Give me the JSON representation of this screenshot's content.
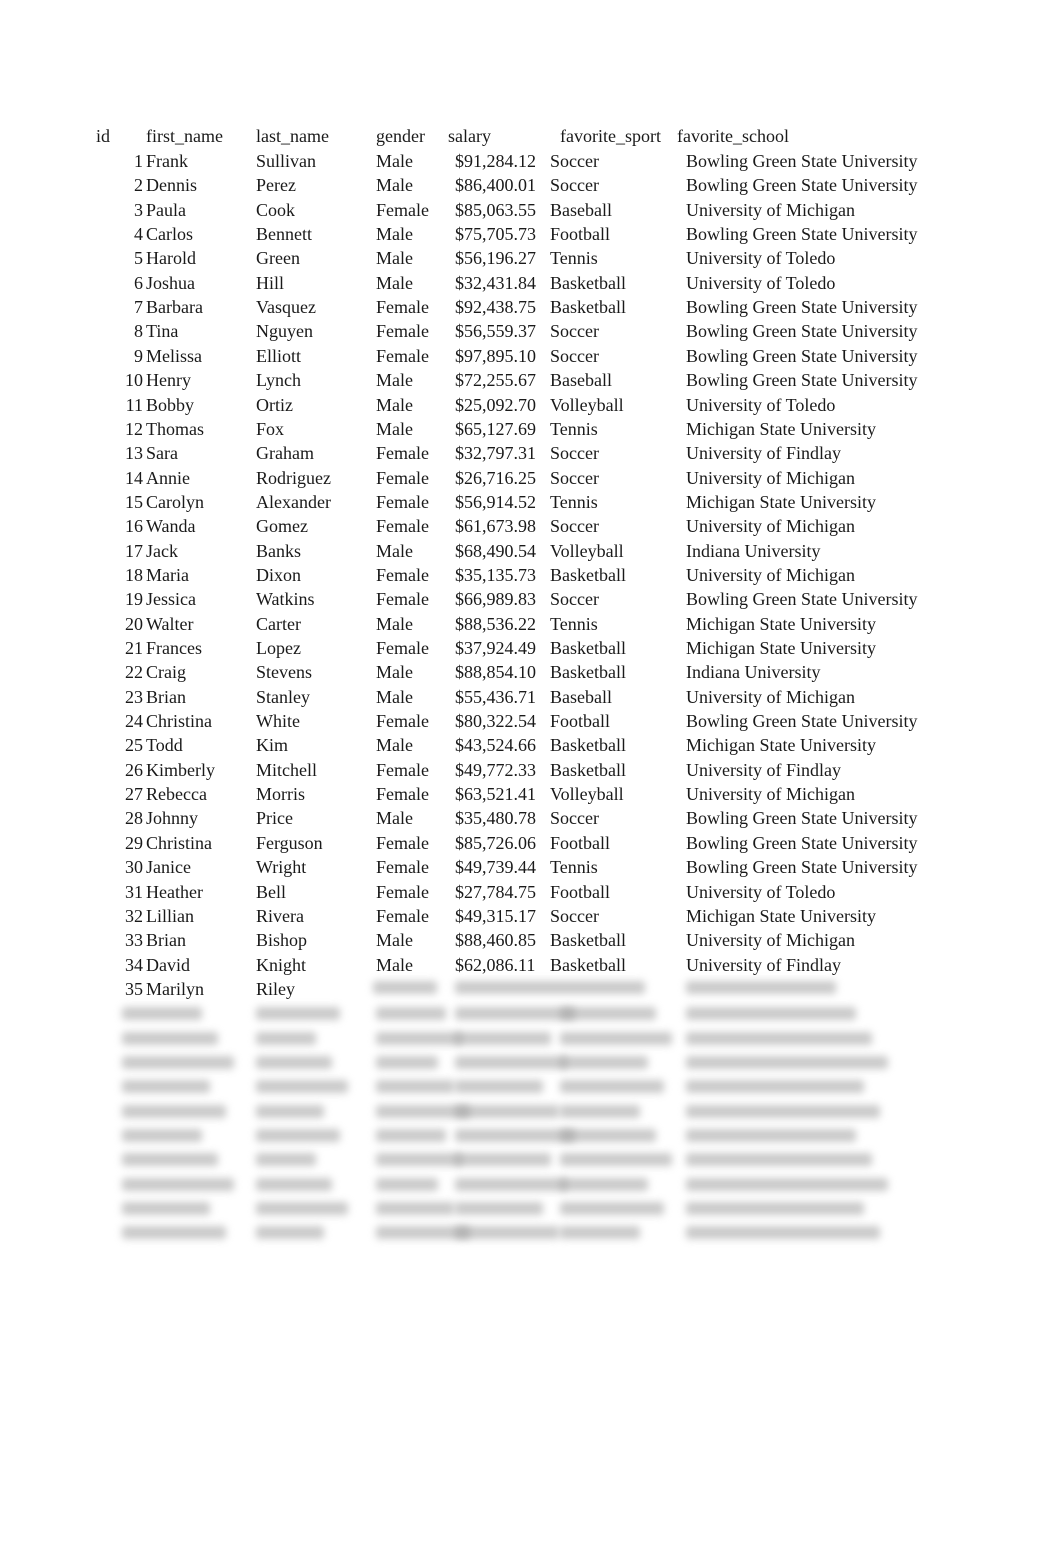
{
  "table": {
    "headers": {
      "id": "id",
      "first_name": "first_name",
      "last_name": "last_name",
      "gender": "gender",
      "salary": "salary",
      "favorite_sport": "favorite_sport",
      "favorite_school": "favorite_school"
    },
    "rows": [
      {
        "id": "1",
        "first_name": "Frank",
        "last_name": "Sullivan",
        "gender": "Male",
        "salary": "$91,284.12",
        "favorite_sport": "Soccer",
        "favorite_school": "Bowling Green State University"
      },
      {
        "id": "2",
        "first_name": "Dennis",
        "last_name": "Perez",
        "gender": "Male",
        "salary": "$86,400.01",
        "favorite_sport": "Soccer",
        "favorite_school": "Bowling Green State University"
      },
      {
        "id": "3",
        "first_name": "Paula",
        "last_name": "Cook",
        "gender": "Female",
        "salary": "$85,063.55",
        "favorite_sport": "Baseball",
        "favorite_school": "University of Michigan"
      },
      {
        "id": "4",
        "first_name": "Carlos",
        "last_name": "Bennett",
        "gender": "Male",
        "salary": "$75,705.73",
        "favorite_sport": "Football",
        "favorite_school": "Bowling Green State University"
      },
      {
        "id": "5",
        "first_name": "Harold",
        "last_name": "Green",
        "gender": "Male",
        "salary": "$56,196.27",
        "favorite_sport": "Tennis",
        "favorite_school": "University of Toledo"
      },
      {
        "id": "6",
        "first_name": "Joshua",
        "last_name": "Hill",
        "gender": "Male",
        "salary": "$32,431.84",
        "favorite_sport": "Basketball",
        "favorite_school": "University of Toledo"
      },
      {
        "id": "7",
        "first_name": "Barbara",
        "last_name": "Vasquez",
        "gender": "Female",
        "salary": "$92,438.75",
        "favorite_sport": "Basketball",
        "favorite_school": "Bowling Green State University"
      },
      {
        "id": "8",
        "first_name": "Tina",
        "last_name": "Nguyen",
        "gender": "Female",
        "salary": "$56,559.37",
        "favorite_sport": "Soccer",
        "favorite_school": "Bowling Green State University"
      },
      {
        "id": "9",
        "first_name": "Melissa",
        "last_name": "Elliott",
        "gender": "Female",
        "salary": "$97,895.10",
        "favorite_sport": "Soccer",
        "favorite_school": "Bowling Green State University"
      },
      {
        "id": "10",
        "first_name": "Henry",
        "last_name": "Lynch",
        "gender": "Male",
        "salary": "$72,255.67",
        "favorite_sport": "Baseball",
        "favorite_school": "Bowling Green State University"
      },
      {
        "id": "11",
        "first_name": "Bobby",
        "last_name": "Ortiz",
        "gender": "Male",
        "salary": "$25,092.70",
        "favorite_sport": "Volleyball",
        "favorite_school": "University of Toledo"
      },
      {
        "id": "12",
        "first_name": "Thomas",
        "last_name": "Fox",
        "gender": "Male",
        "salary": "$65,127.69",
        "favorite_sport": "Tennis",
        "favorite_school": "Michigan State University"
      },
      {
        "id": "13",
        "first_name": "Sara",
        "last_name": "Graham",
        "gender": "Female",
        "salary": "$32,797.31",
        "favorite_sport": "Soccer",
        "favorite_school": "University of Findlay"
      },
      {
        "id": "14",
        "first_name": "Annie",
        "last_name": "Rodriguez",
        "gender": "Female",
        "salary": "$26,716.25",
        "favorite_sport": "Soccer",
        "favorite_school": "University of Michigan"
      },
      {
        "id": "15",
        "first_name": "Carolyn",
        "last_name": "Alexander",
        "gender": "Female",
        "salary": "$56,914.52",
        "favorite_sport": "Tennis",
        "favorite_school": "Michigan State University"
      },
      {
        "id": "16",
        "first_name": "Wanda",
        "last_name": "Gomez",
        "gender": "Female",
        "salary": "$61,673.98",
        "favorite_sport": "Soccer",
        "favorite_school": "University of Michigan"
      },
      {
        "id": "17",
        "first_name": "Jack",
        "last_name": "Banks",
        "gender": "Male",
        "salary": "$68,490.54",
        "favorite_sport": "Volleyball",
        "favorite_school": "Indiana University"
      },
      {
        "id": "18",
        "first_name": "Maria",
        "last_name": "Dixon",
        "gender": "Female",
        "salary": "$35,135.73",
        "favorite_sport": "Basketball",
        "favorite_school": "University of Michigan"
      },
      {
        "id": "19",
        "first_name": "Jessica",
        "last_name": "Watkins",
        "gender": "Female",
        "salary": "$66,989.83",
        "favorite_sport": "Soccer",
        "favorite_school": "Bowling Green State University"
      },
      {
        "id": "20",
        "first_name": "Walter",
        "last_name": "Carter",
        "gender": "Male",
        "salary": "$88,536.22",
        "favorite_sport": "Tennis",
        "favorite_school": "Michigan State University"
      },
      {
        "id": "21",
        "first_name": "Frances",
        "last_name": "Lopez",
        "gender": "Female",
        "salary": "$37,924.49",
        "favorite_sport": "Basketball",
        "favorite_school": "Michigan State University"
      },
      {
        "id": "22",
        "first_name": "Craig",
        "last_name": "Stevens",
        "gender": "Male",
        "salary": "$88,854.10",
        "favorite_sport": "Basketball",
        "favorite_school": "Indiana University"
      },
      {
        "id": "23",
        "first_name": "Brian",
        "last_name": "Stanley",
        "gender": "Male",
        "salary": "$55,436.71",
        "favorite_sport": "Baseball",
        "favorite_school": "University of Michigan"
      },
      {
        "id": "24",
        "first_name": "Christina",
        "last_name": "White",
        "gender": "Female",
        "salary": "$80,322.54",
        "favorite_sport": "Football",
        "favorite_school": "Bowling Green State University"
      },
      {
        "id": "25",
        "first_name": "Todd",
        "last_name": "Kim",
        "gender": "Male",
        "salary": "$43,524.66",
        "favorite_sport": "Basketball",
        "favorite_school": "Michigan State University"
      },
      {
        "id": "26",
        "first_name": "Kimberly",
        "last_name": "Mitchell",
        "gender": "Female",
        "salary": "$49,772.33",
        "favorite_sport": "Basketball",
        "favorite_school": "University of Findlay"
      },
      {
        "id": "27",
        "first_name": "Rebecca",
        "last_name": "Morris",
        "gender": "Female",
        "salary": "$63,521.41",
        "favorite_sport": "Volleyball",
        "favorite_school": "University of Michigan"
      },
      {
        "id": "28",
        "first_name": "Johnny",
        "last_name": "Price",
        "gender": "Male",
        "salary": "$35,480.78",
        "favorite_sport": "Soccer",
        "favorite_school": "Bowling Green State University"
      },
      {
        "id": "29",
        "first_name": "Christina",
        "last_name": "Ferguson",
        "gender": "Female",
        "salary": "$85,726.06",
        "favorite_sport": "Football",
        "favorite_school": "Bowling Green State University"
      },
      {
        "id": "30",
        "first_name": "Janice",
        "last_name": "Wright",
        "gender": "Female",
        "salary": "$49,739.44",
        "favorite_sport": "Tennis",
        "favorite_school": "Bowling Green State University"
      },
      {
        "id": "31",
        "first_name": "Heather",
        "last_name": "Bell",
        "gender": "Female",
        "salary": "$27,784.75",
        "favorite_sport": "Football",
        "favorite_school": "University of Toledo"
      },
      {
        "id": "32",
        "first_name": "Lillian",
        "last_name": "Rivera",
        "gender": "Female",
        "salary": "$49,315.17",
        "favorite_sport": "Soccer",
        "favorite_school": "Michigan State University"
      },
      {
        "id": "33",
        "first_name": "Brian",
        "last_name": "Bishop",
        "gender": "Male",
        "salary": "$88,460.85",
        "favorite_sport": "Basketball",
        "favorite_school": "University of Michigan"
      },
      {
        "id": "34",
        "first_name": "David",
        "last_name": "Knight",
        "gender": "Male",
        "salary": "$62,086.11",
        "favorite_sport": "Basketball",
        "favorite_school": "University of Findlay"
      },
      {
        "id": "35",
        "first_name": "Marilyn",
        "last_name": "Riley",
        "gender": "",
        "salary": "",
        "favorite_sport": "",
        "favorite_school": ""
      }
    ],
    "blurred_row_count": 10
  }
}
